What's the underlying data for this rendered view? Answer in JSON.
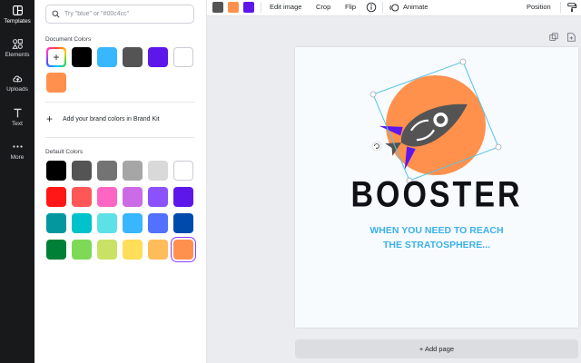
{
  "rail": {
    "items": [
      {
        "label": "Templates",
        "icon": "templates-icon"
      },
      {
        "label": "Elements",
        "icon": "elements-icon"
      },
      {
        "label": "Uploads",
        "icon": "cloud-upload-icon"
      },
      {
        "label": "Text",
        "icon": "text-icon"
      },
      {
        "label": "More",
        "icon": "more-dots-icon"
      }
    ]
  },
  "panel": {
    "search_placeholder": "Try \"blue\" or \"#00c4cc\"",
    "document_colors_title": "Document Colors",
    "document_colors": [
      "#000000",
      "#38b6ff",
      "#545454",
      "#5e17eb",
      "#ffffff",
      "#ff914d"
    ],
    "brand_kit_label": "Add your brand colors in Brand Kit",
    "default_colors_title": "Default Colors",
    "default_colors": [
      [
        "#000000",
        "#545454",
        "#737373",
        "#a6a6a6",
        "#d9d9d9",
        "#ffffff"
      ],
      [
        "#ff1616",
        "#ff5757",
        "#ff66c4",
        "#cb6ce6",
        "#8c52ff",
        "#5e17eb"
      ],
      [
        "#03989e",
        "#00c2cb",
        "#5ce1e6",
        "#38b6ff",
        "#5271ff",
        "#004aad"
      ],
      [
        "#008037",
        "#7ed957",
        "#c9e265",
        "#ffde59",
        "#ffbd59",
        "#ff914d"
      ]
    ],
    "selected_color": "#ff914d"
  },
  "toolbar": {
    "colors": [
      "#545454",
      "#ff914d",
      "#5e17eb"
    ],
    "edit_image": "Edit image",
    "crop": "Crop",
    "flip": "Flip",
    "animate": "Animate",
    "position": "Position"
  },
  "design": {
    "title": "BOOSTER",
    "tagline_line1": "WHEN YOU NEED TO REACH",
    "tagline_line2": "THE STRATOSPHERE...",
    "logo_colors": {
      "circle": "#ff914d",
      "rocket": "#545454",
      "fins": "#5e17eb"
    }
  },
  "add_page_label": "+ Add page"
}
